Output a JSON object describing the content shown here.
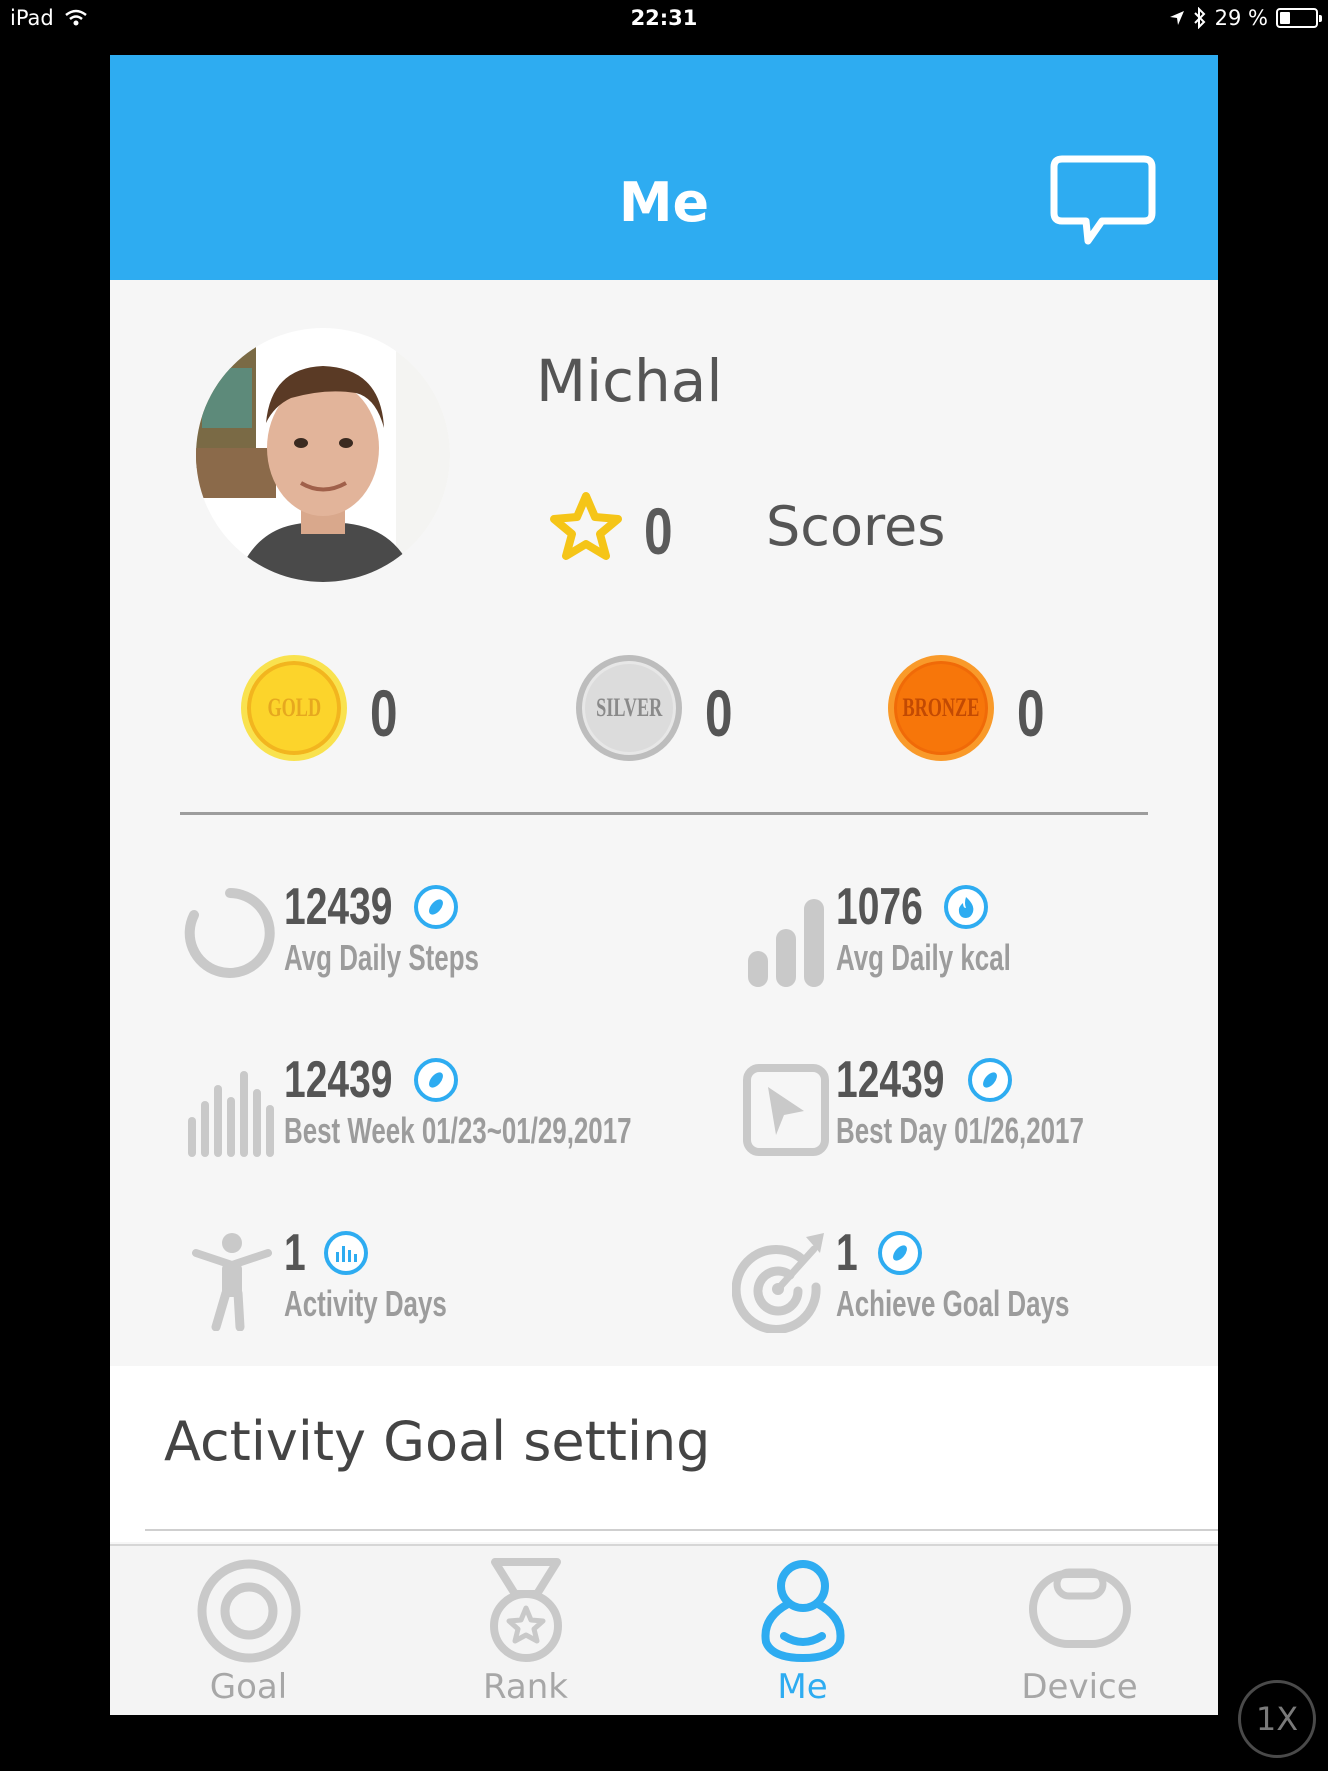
{
  "status_bar": {
    "device": "iPad",
    "time": "22:31",
    "battery": "29 %"
  },
  "header": {
    "title": "Me",
    "message_icon": "chat-bubble-icon"
  },
  "profile": {
    "name": "Michal",
    "score_value": "0",
    "score_label": "Scores"
  },
  "medals": [
    {
      "label": "GOLD",
      "count": "0",
      "color": "#fcd42b"
    },
    {
      "label": "SILVER",
      "count": "0",
      "color": "#dcdcdc"
    },
    {
      "label": "BRONZE",
      "count": "0",
      "color": "#f7760a"
    }
  ],
  "stats": [
    {
      "value": "12439",
      "label": "Avg Daily Steps",
      "icon": "ring-icon",
      "badge": "steps-badge-icon"
    },
    {
      "value": "1076",
      "label": "Avg Daily kcal",
      "icon": "bar-chart-icon",
      "badge": "flame-badge-icon"
    },
    {
      "value": "12439",
      "label": "Best Week 01/23~01/29,2017",
      "icon": "bars-icon",
      "badge": "steps-badge-icon"
    },
    {
      "value": "12439",
      "label": "Best Day 01/26,2017",
      "icon": "flag-icon",
      "badge": "steps-badge-icon"
    },
    {
      "value": "1",
      "label": "Activity Days",
      "icon": "person-icon",
      "badge": "chart-badge-icon"
    },
    {
      "value": "1",
      "label": "Achieve Goal Days",
      "icon": "target-icon",
      "badge": "steps-badge-icon"
    }
  ],
  "goal_setting": {
    "label": "Activity Goal setting"
  },
  "tabs": [
    {
      "label": "Goal",
      "active": false
    },
    {
      "label": "Rank",
      "active": false
    },
    {
      "label": "Me",
      "active": true
    },
    {
      "label": "Device",
      "active": false
    }
  ],
  "zoom": "1X",
  "colors": {
    "accent": "#2eacf1",
    "text": "#555555",
    "muted": "#9c9c9c"
  }
}
